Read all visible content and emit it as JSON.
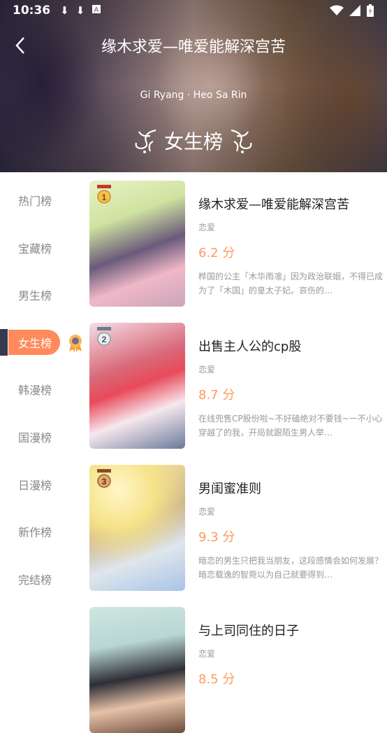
{
  "status_bar": {
    "time": "10:36"
  },
  "header": {
    "title": "缘木求爱—唯爱能解深宫苦",
    "authors": "Gi Ryang · Heo Sa Rin",
    "rank_title": "女生榜"
  },
  "sidebar": {
    "items": [
      {
        "label": "热门榜"
      },
      {
        "label": "宝藏榜"
      },
      {
        "label": "男生榜"
      },
      {
        "label": "女生榜"
      },
      {
        "label": "韩漫榜"
      },
      {
        "label": "国漫榜"
      },
      {
        "label": "日漫榜"
      },
      {
        "label": "新作榜"
      },
      {
        "label": "完结榜"
      }
    ],
    "active_index": 3
  },
  "books": [
    {
      "rank": "1",
      "title": "缘木求爱—唯爱能解深宫苦",
      "genre": "恋爱",
      "score": "6.2 分",
      "desc": "桦国的公主「木华雨凛」因为政治联姻，不得已成为了「木国」的皇太子妃。哀伤的…"
    },
    {
      "rank": "2",
      "title": "出售主人公的cp股",
      "genre": "恋爱",
      "score": "8.7 分",
      "desc": "在线兜售CP股份啦~不好磕绝对不要钱~一不小心穿越了的我，开局就跟陌生男人举…"
    },
    {
      "rank": "3",
      "title": "男闺蜜准则",
      "genre": "恋爱",
      "score": "9.3 分",
      "desc": "暗恋的男生只把我当朋友，这段感情会如何发展？暗恋载逸的智菀以为自己就要得到…"
    },
    {
      "rank": "",
      "title": "与上司同住的日子",
      "genre": "恋爱",
      "score": "8.5 分",
      "desc": ""
    }
  ],
  "colors": {
    "accent": "#ff8a5b",
    "score": "#ff9a62",
    "active_bar": "#353a4e"
  }
}
